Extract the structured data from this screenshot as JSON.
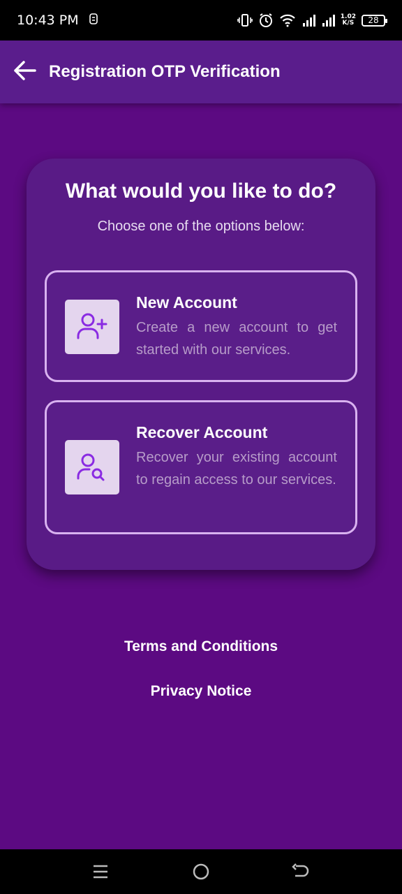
{
  "status_bar": {
    "time": "10:43 PM",
    "net_speed_value": "1.02",
    "net_speed_unit": "K/S",
    "battery": "28",
    "icons": [
      "sync-icon",
      "vibrate-icon",
      "alarm-icon",
      "wifi-icon",
      "signal-icon",
      "signal-icon",
      "battery-icon"
    ]
  },
  "app_bar": {
    "title": "Registration OTP Verification",
    "back_icon": "arrow-left-icon"
  },
  "card": {
    "title": "What would you like to do?",
    "subtitle": "Choose one of the options below:",
    "options": [
      {
        "icon": "user-plus-icon",
        "title": "New Account",
        "description": "Create a new account to get started with our services."
      },
      {
        "icon": "user-search-icon",
        "title": "Recover Account",
        "description": "Recover your existing account to regain access to our services."
      }
    ]
  },
  "links": {
    "terms": "Terms and Conditions",
    "privacy": "Privacy Notice"
  },
  "nav_bar": {
    "icons": [
      "menu-icon",
      "home-icon",
      "back-icon"
    ]
  },
  "colors": {
    "background": "#5c0a82",
    "app_bar": "#5a1d8c",
    "card": "#591b86",
    "option_border": "#d9b2f0",
    "icon_tile": "#e4d5ee",
    "icon_accent": "#8a2be2"
  }
}
